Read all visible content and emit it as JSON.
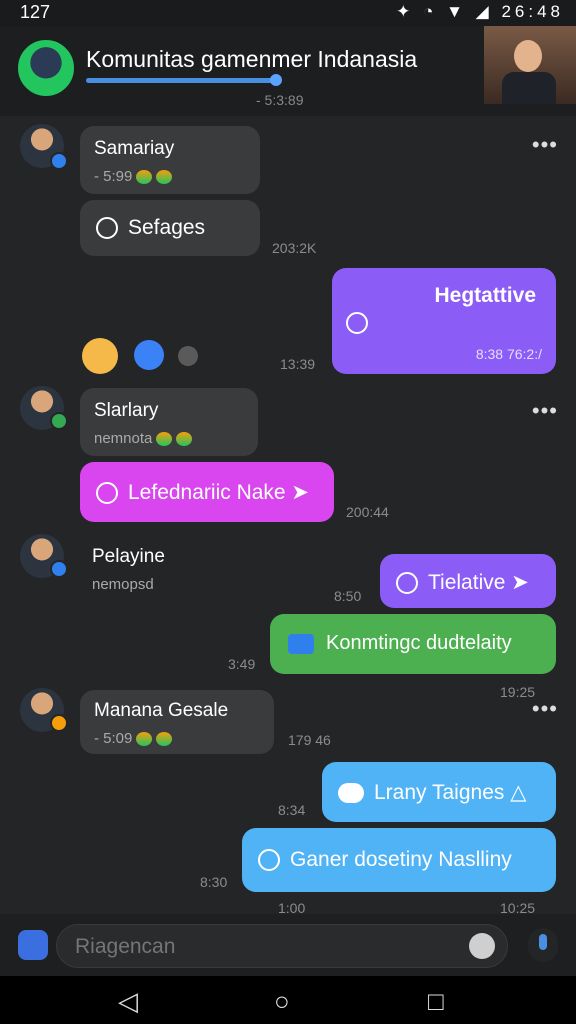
{
  "status": {
    "left": "127",
    "time": "26:48"
  },
  "header": {
    "title": "Komunitas gamenmer Indanasia",
    "subtitle": "- 5:3:89"
  },
  "messages": [
    {
      "name": "Samariay",
      "meta": "- 5:99",
      "stamp": "203:2K"
    },
    {
      "text": "Sefages"
    },
    {
      "text": "Hegtattive",
      "meta": "8:38 76:2:/",
      "stamp": "13:39"
    },
    {
      "name": "Slarlary",
      "meta": "nemnota"
    },
    {
      "text": "Lefednariic Nake",
      "stamp": "200:44"
    },
    {
      "name": "Pelayine",
      "meta": "nemopsd"
    },
    {
      "text": "Tielative",
      "stamp": "8:50"
    },
    {
      "text": "Konmtingc dudtelaity",
      "stamp_left": "3:49",
      "stamp_right": "19:25"
    },
    {
      "name": "Manana Gesale",
      "meta": "- 5:09",
      "stamp": "179 46"
    },
    {
      "text": "Lrany Taignes",
      "stamp": "8:34"
    },
    {
      "text": "Ganer dosetiny Naslliny",
      "stamp": "8:30",
      "stamp_left": "1:00",
      "stamp_right": "10:25"
    }
  ],
  "composer": {
    "placeholder": "Riagencan"
  },
  "colors": {
    "purple": "#8b5cf6",
    "magenta": "#d946ef",
    "green": "#4caf50",
    "blue": "#4fb3f6"
  }
}
